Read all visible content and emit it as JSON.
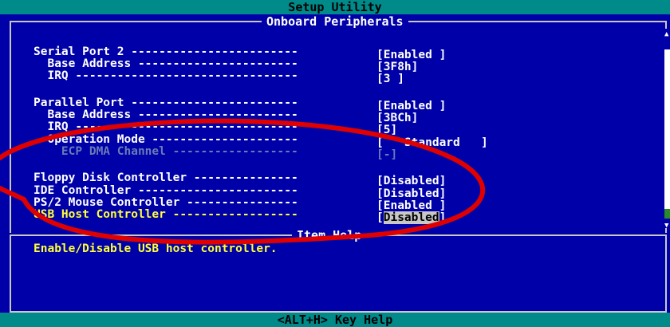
{
  "header": {
    "title": "Setup Utility"
  },
  "panel": {
    "title": "Onboard Peripherals",
    "rows": [
      {
        "label": "Serial Port 2 ------------------------",
        "value": "[Enabled ]"
      },
      {
        "label": "  Base Address -----------------------",
        "value": "[3F8h]"
      },
      {
        "label": "  IRQ --------------------------------",
        "value": "[3 ]"
      },
      {
        "label": "Parallel Port ------------------------",
        "value": "[Enabled ]"
      },
      {
        "label": "  Base Address -----------------------",
        "value": "[3BCh]"
      },
      {
        "label": "  IRQ --------------------------------",
        "value": "[5]"
      },
      {
        "label": "  Operation Mode ---------------------",
        "value": "[   Standard   ]"
      },
      {
        "label": "    ECP DMA Channel ------------------",
        "value": "[-]"
      },
      {
        "label": "Floppy Disk Controller ---------------",
        "value": "[Disabled]"
      },
      {
        "label": "IDE Controller -----------------------",
        "value": "[Disabled]"
      },
      {
        "label": "PS/2 Mouse Controller ----------------",
        "value": "[Enabled ]"
      },
      {
        "label": "USB Host Controller ------------------",
        "value": "Disabled"
      }
    ]
  },
  "help": {
    "title": "Item Help",
    "text": "Enable/Disable USB host controller."
  },
  "footer": {
    "text": "<ALT+H>  Key Help"
  },
  "colors": {
    "background": "#0000a8",
    "bar": "#008a8a",
    "highlight": "#ffff3a",
    "annotation": "#e00000"
  }
}
